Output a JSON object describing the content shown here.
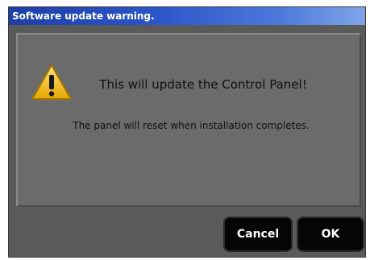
{
  "window": {
    "title": "Software update warning."
  },
  "message": {
    "icon": "warning-icon",
    "headline": "This will update the Control Panel!",
    "detail": "The panel will reset when installation completes."
  },
  "buttons": {
    "cancel_label": "Cancel",
    "ok_label": "OK"
  },
  "colors": {
    "titlebar_start": "#1e3fa8",
    "titlebar_end": "#7fa5e8",
    "dialog_background": "#5a5a5a",
    "panel_background": "#6b6b6b",
    "button_background": "#050505",
    "warning_yellow": "#f2c21b"
  }
}
